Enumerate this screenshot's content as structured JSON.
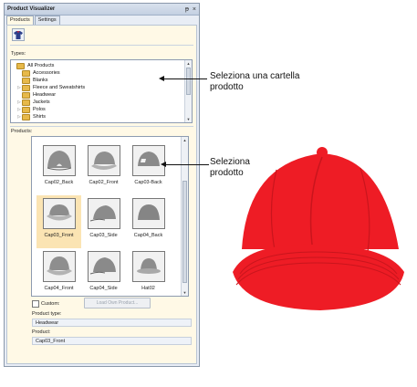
{
  "window": {
    "title": "Product Visualizer",
    "controls": {
      "pin": "ᵽ",
      "close": "×"
    }
  },
  "tabs": [
    {
      "label": "Products",
      "active": true
    },
    {
      "label": "Settings",
      "active": false
    }
  ],
  "types": {
    "label": "Types:",
    "items": [
      {
        "label": "All Products",
        "expander": ""
      },
      {
        "label": "Accessories",
        "expander": ""
      },
      {
        "label": "Blanks",
        "expander": ""
      },
      {
        "label": "Fleece and Sweatshirts",
        "expander": "▷"
      },
      {
        "label": "Headwear",
        "expander": ""
      },
      {
        "label": "Jackets",
        "expander": "▷"
      },
      {
        "label": "Polos",
        "expander": "▷"
      },
      {
        "label": "Shirts",
        "expander": "▷"
      }
    ]
  },
  "products": {
    "label": "Products:",
    "items": [
      {
        "label": "Cap02_Back",
        "selected": false
      },
      {
        "label": "Cap02_Front",
        "selected": false
      },
      {
        "label": "Cap03-Back",
        "selected": false
      },
      {
        "label": "Cap03_Front",
        "selected": true
      },
      {
        "label": "Cap03_Side",
        "selected": false
      },
      {
        "label": "Cap04_Back",
        "selected": false
      },
      {
        "label": "Cap04_Front",
        "selected": false
      },
      {
        "label": "Cap04_Side",
        "selected": false
      },
      {
        "label": "Hat02",
        "selected": false
      }
    ]
  },
  "custom": {
    "label": "Custom:",
    "checked": false
  },
  "load_button": {
    "label": "Load Own Product..."
  },
  "product_type": {
    "label": "Product type:",
    "value": "Headwear"
  },
  "product": {
    "label": "Product:",
    "value": "Cap03_Front"
  },
  "callouts": {
    "types": "Seleziona una cartella prodotto",
    "products": "Seleziona prodotto"
  },
  "preview": {
    "color": "#ee1c25",
    "name": "cap-preview"
  }
}
